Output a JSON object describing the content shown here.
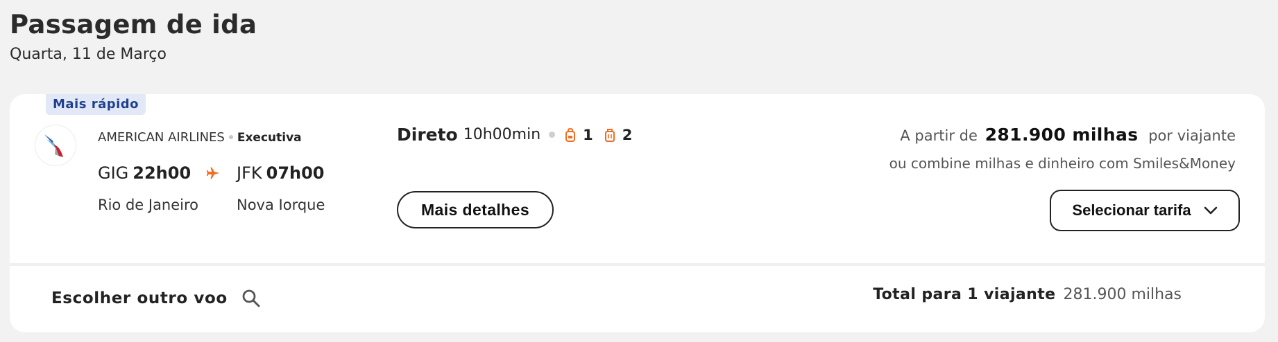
{
  "header": {
    "title": "Passagem de ida",
    "date": "Quarta, 11 de Março"
  },
  "flight": {
    "badge": "Mais rápido",
    "airline": "AMERICAN AIRLINES",
    "cabin": "Executiva",
    "departure": {
      "code": "GIG",
      "time": "22h00",
      "city": "Rio de Janeiro"
    },
    "arrival": {
      "code": "JFK",
      "time": "07h00",
      "city": "Nova Iorque"
    },
    "stops": "Direto",
    "duration": "10h00min",
    "carry_on_count": "1",
    "checked_bag_count": "2",
    "details_label": "Mais detalhes"
  },
  "pricing": {
    "from_label": "A partir de",
    "price": "281.900 milhas",
    "per_label": "por viajante",
    "combine_text": "ou combine milhas e dinheiro com Smiles&Money",
    "select_label": "Selecionar tarifa"
  },
  "footer": {
    "other_flight_label": "Escolher outro voo",
    "total_label": "Total para 1 viajante",
    "total_value": "281.900 milhas"
  },
  "colors": {
    "accent": "#f26b21",
    "badge_bg": "#e3e8f6",
    "badge_text": "#1f3f8f"
  },
  "icons": [
    "american-airlines-logo",
    "plane-icon",
    "backpack-icon",
    "suitcase-icon",
    "chevron-down-icon",
    "search-icon"
  ]
}
